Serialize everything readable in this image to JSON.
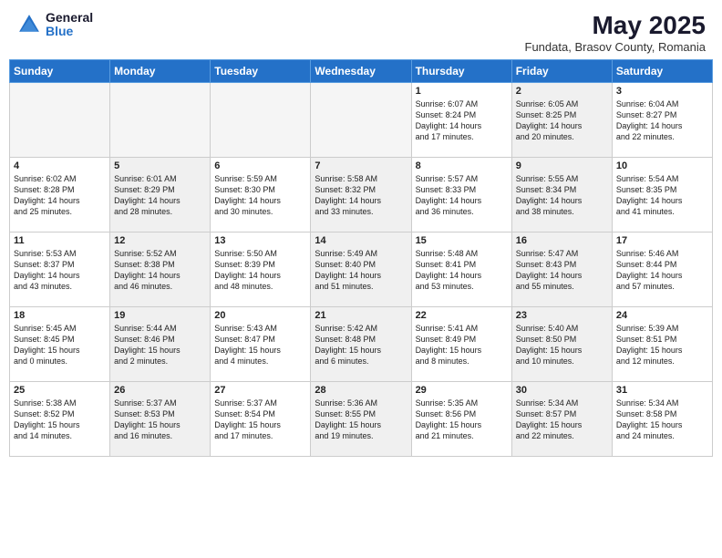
{
  "header": {
    "logo_general": "General",
    "logo_blue": "Blue",
    "month_title": "May 2025",
    "location": "Fundata, Brasov County, Romania"
  },
  "days_of_week": [
    "Sunday",
    "Monday",
    "Tuesday",
    "Wednesday",
    "Thursday",
    "Friday",
    "Saturday"
  ],
  "weeks": [
    [
      {
        "num": "",
        "info": "",
        "empty": true
      },
      {
        "num": "",
        "info": "",
        "empty": true
      },
      {
        "num": "",
        "info": "",
        "empty": true
      },
      {
        "num": "",
        "info": "",
        "empty": true
      },
      {
        "num": "1",
        "info": "Sunrise: 6:07 AM\nSunset: 8:24 PM\nDaylight: 14 hours\nand 17 minutes.",
        "empty": false,
        "shaded": false
      },
      {
        "num": "2",
        "info": "Sunrise: 6:05 AM\nSunset: 8:25 PM\nDaylight: 14 hours\nand 20 minutes.",
        "empty": false,
        "shaded": true
      },
      {
        "num": "3",
        "info": "Sunrise: 6:04 AM\nSunset: 8:27 PM\nDaylight: 14 hours\nand 22 minutes.",
        "empty": false,
        "shaded": false
      }
    ],
    [
      {
        "num": "4",
        "info": "Sunrise: 6:02 AM\nSunset: 8:28 PM\nDaylight: 14 hours\nand 25 minutes.",
        "empty": false,
        "shaded": false
      },
      {
        "num": "5",
        "info": "Sunrise: 6:01 AM\nSunset: 8:29 PM\nDaylight: 14 hours\nand 28 minutes.",
        "empty": false,
        "shaded": true
      },
      {
        "num": "6",
        "info": "Sunrise: 5:59 AM\nSunset: 8:30 PM\nDaylight: 14 hours\nand 30 minutes.",
        "empty": false,
        "shaded": false
      },
      {
        "num": "7",
        "info": "Sunrise: 5:58 AM\nSunset: 8:32 PM\nDaylight: 14 hours\nand 33 minutes.",
        "empty": false,
        "shaded": true
      },
      {
        "num": "8",
        "info": "Sunrise: 5:57 AM\nSunset: 8:33 PM\nDaylight: 14 hours\nand 36 minutes.",
        "empty": false,
        "shaded": false
      },
      {
        "num": "9",
        "info": "Sunrise: 5:55 AM\nSunset: 8:34 PM\nDaylight: 14 hours\nand 38 minutes.",
        "empty": false,
        "shaded": true
      },
      {
        "num": "10",
        "info": "Sunrise: 5:54 AM\nSunset: 8:35 PM\nDaylight: 14 hours\nand 41 minutes.",
        "empty": false,
        "shaded": false
      }
    ],
    [
      {
        "num": "11",
        "info": "Sunrise: 5:53 AM\nSunset: 8:37 PM\nDaylight: 14 hours\nand 43 minutes.",
        "empty": false,
        "shaded": false
      },
      {
        "num": "12",
        "info": "Sunrise: 5:52 AM\nSunset: 8:38 PM\nDaylight: 14 hours\nand 46 minutes.",
        "empty": false,
        "shaded": true
      },
      {
        "num": "13",
        "info": "Sunrise: 5:50 AM\nSunset: 8:39 PM\nDaylight: 14 hours\nand 48 minutes.",
        "empty": false,
        "shaded": false
      },
      {
        "num": "14",
        "info": "Sunrise: 5:49 AM\nSunset: 8:40 PM\nDaylight: 14 hours\nand 51 minutes.",
        "empty": false,
        "shaded": true
      },
      {
        "num": "15",
        "info": "Sunrise: 5:48 AM\nSunset: 8:41 PM\nDaylight: 14 hours\nand 53 minutes.",
        "empty": false,
        "shaded": false
      },
      {
        "num": "16",
        "info": "Sunrise: 5:47 AM\nSunset: 8:43 PM\nDaylight: 14 hours\nand 55 minutes.",
        "empty": false,
        "shaded": true
      },
      {
        "num": "17",
        "info": "Sunrise: 5:46 AM\nSunset: 8:44 PM\nDaylight: 14 hours\nand 57 minutes.",
        "empty": false,
        "shaded": false
      }
    ],
    [
      {
        "num": "18",
        "info": "Sunrise: 5:45 AM\nSunset: 8:45 PM\nDaylight: 15 hours\nand 0 minutes.",
        "empty": false,
        "shaded": false
      },
      {
        "num": "19",
        "info": "Sunrise: 5:44 AM\nSunset: 8:46 PM\nDaylight: 15 hours\nand 2 minutes.",
        "empty": false,
        "shaded": true
      },
      {
        "num": "20",
        "info": "Sunrise: 5:43 AM\nSunset: 8:47 PM\nDaylight: 15 hours\nand 4 minutes.",
        "empty": false,
        "shaded": false
      },
      {
        "num": "21",
        "info": "Sunrise: 5:42 AM\nSunset: 8:48 PM\nDaylight: 15 hours\nand 6 minutes.",
        "empty": false,
        "shaded": true
      },
      {
        "num": "22",
        "info": "Sunrise: 5:41 AM\nSunset: 8:49 PM\nDaylight: 15 hours\nand 8 minutes.",
        "empty": false,
        "shaded": false
      },
      {
        "num": "23",
        "info": "Sunrise: 5:40 AM\nSunset: 8:50 PM\nDaylight: 15 hours\nand 10 minutes.",
        "empty": false,
        "shaded": true
      },
      {
        "num": "24",
        "info": "Sunrise: 5:39 AM\nSunset: 8:51 PM\nDaylight: 15 hours\nand 12 minutes.",
        "empty": false,
        "shaded": false
      }
    ],
    [
      {
        "num": "25",
        "info": "Sunrise: 5:38 AM\nSunset: 8:52 PM\nDaylight: 15 hours\nand 14 minutes.",
        "empty": false,
        "shaded": false
      },
      {
        "num": "26",
        "info": "Sunrise: 5:37 AM\nSunset: 8:53 PM\nDaylight: 15 hours\nand 16 minutes.",
        "empty": false,
        "shaded": true
      },
      {
        "num": "27",
        "info": "Sunrise: 5:37 AM\nSunset: 8:54 PM\nDaylight: 15 hours\nand 17 minutes.",
        "empty": false,
        "shaded": false
      },
      {
        "num": "28",
        "info": "Sunrise: 5:36 AM\nSunset: 8:55 PM\nDaylight: 15 hours\nand 19 minutes.",
        "empty": false,
        "shaded": true
      },
      {
        "num": "29",
        "info": "Sunrise: 5:35 AM\nSunset: 8:56 PM\nDaylight: 15 hours\nand 21 minutes.",
        "empty": false,
        "shaded": false
      },
      {
        "num": "30",
        "info": "Sunrise: 5:34 AM\nSunset: 8:57 PM\nDaylight: 15 hours\nand 22 minutes.",
        "empty": false,
        "shaded": true
      },
      {
        "num": "31",
        "info": "Sunrise: 5:34 AM\nSunset: 8:58 PM\nDaylight: 15 hours\nand 24 minutes.",
        "empty": false,
        "shaded": false
      }
    ]
  ]
}
